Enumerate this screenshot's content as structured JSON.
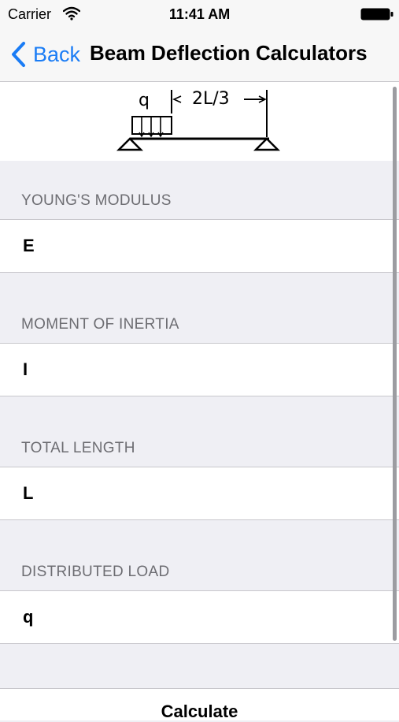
{
  "status_bar": {
    "carrier": "Carrier",
    "time": "11:41 AM",
    "wifi_icon": "wifi-icon",
    "battery_icon": "battery-icon"
  },
  "nav_bar": {
    "back_label": "Back",
    "back_icon": "chevron-left-icon",
    "title": "Beam Deflection Calculators",
    "accent_color": "#1a7cf5"
  },
  "diagram": {
    "load_label": "q",
    "dimension_label": "2L/3"
  },
  "fields": [
    {
      "header": "YOUNG'S MODULUS",
      "placeholder": "E"
    },
    {
      "header": "MOMENT OF INERTIA",
      "placeholder": "I"
    },
    {
      "header": "TOTAL LENGTH",
      "placeholder": "L"
    },
    {
      "header": "DISTRIBUTED LOAD",
      "placeholder": "q"
    }
  ],
  "actions": {
    "calculate_label": "Calculate"
  }
}
